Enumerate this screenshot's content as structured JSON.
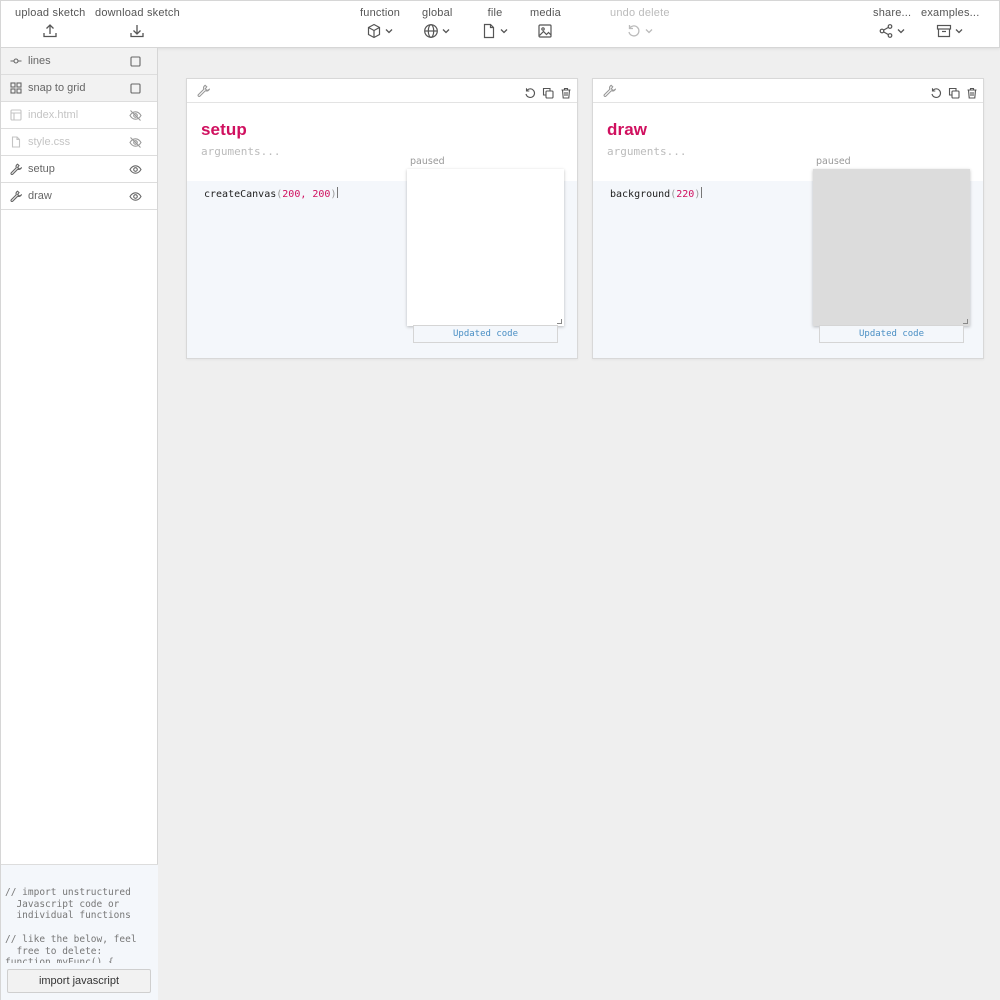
{
  "toolbar": {
    "upload": "upload sketch",
    "download": "download sketch",
    "function": "function",
    "global": "global",
    "file": "file",
    "media": "media",
    "undo": "undo delete",
    "share": "share...",
    "examples": "examples..."
  },
  "sidebar": {
    "items": [
      {
        "label": "lines",
        "icon": "commit-icon",
        "right": "checkbox-icon"
      },
      {
        "label": "snap to grid",
        "icon": "grid-icon",
        "right": "checkbox-icon"
      },
      {
        "label": "index.html",
        "icon": "layout-icon",
        "right": "eye-off-icon"
      },
      {
        "label": "style.css",
        "icon": "file-icon",
        "right": "eye-off-icon"
      },
      {
        "label": "setup",
        "icon": "wrench-icon",
        "right": "eye-icon"
      },
      {
        "label": "draw",
        "icon": "wrench-icon",
        "right": "eye-icon"
      }
    ],
    "import_code": "// import unstructured\n  Javascript code or\n  individual functions\n\n// like the below, feel\n  free to delete:\nfunction myFunc() {",
    "import_button": "import javascript"
  },
  "panels": [
    {
      "name": "setup",
      "arguments_placeholder": "arguments...",
      "code_fn": "createCanvas",
      "code_args": "200, 200",
      "paused": "paused",
      "canvas_color": "#ffffff",
      "updated": "Updated code"
    },
    {
      "name": "draw",
      "arguments_placeholder": "arguments...",
      "code_fn": "background",
      "code_args": "220",
      "paused": "paused",
      "canvas_color": "#dcdcdc",
      "updated": "Updated code"
    }
  ],
  "colors": {
    "accent": "#d0105f",
    "link": "#4a8fc4"
  }
}
